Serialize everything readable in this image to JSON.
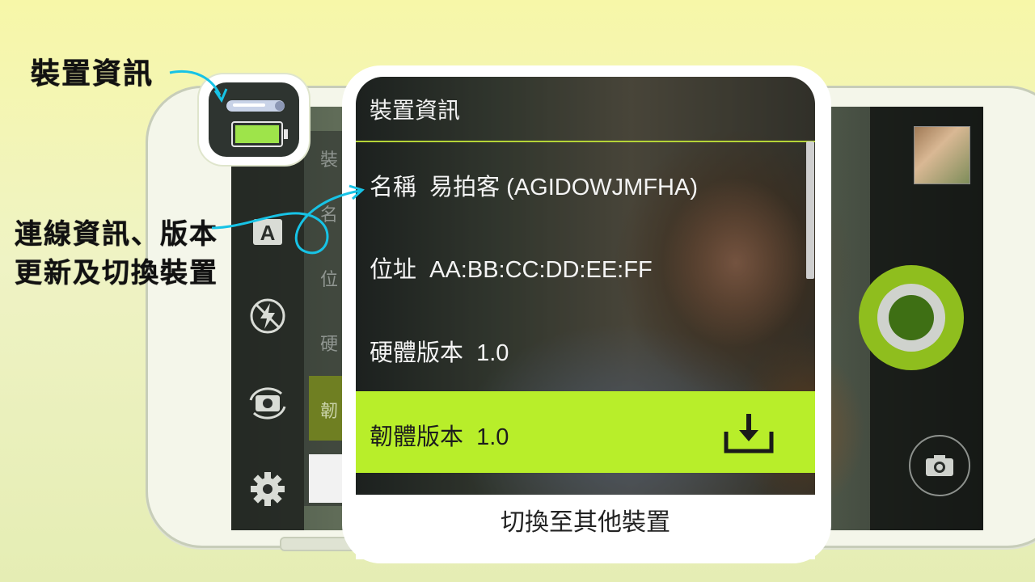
{
  "annotations": {
    "device_info": "裝置資訊",
    "connection_line1": "連線資訊、版本",
    "connection_line2": "更新及切換裝置"
  },
  "background_panel": {
    "items": [
      "裝",
      "名",
      "位",
      "硬",
      "韌"
    ]
  },
  "sidebar": {
    "icons": [
      "auto-mode-icon",
      "flash-off-icon",
      "switch-camera-icon",
      "settings-gear-icon"
    ],
    "auto_label": "A"
  },
  "device_panel": {
    "title": "裝置資訊",
    "name_row": "名稱  易拍客 (AGIDOWJMFHA)",
    "address_row": "位址  AA:BB:CC:DD:EE:FF",
    "hardware_row": "硬體版本  1.0",
    "firmware_row": "韌體版本  1.0",
    "firmware_action_icon": "download-icon",
    "switch_device_button": "切換至其他裝置"
  },
  "colors": {
    "accent_green": "#b8ee2a",
    "shutter_green": "#8fbe1e",
    "arrow_cyan": "#17c3e6",
    "background": "#f4f6c0"
  },
  "status": {
    "battery_icon": "battery-full-icon",
    "connection_icon": "stick-device-icon"
  }
}
